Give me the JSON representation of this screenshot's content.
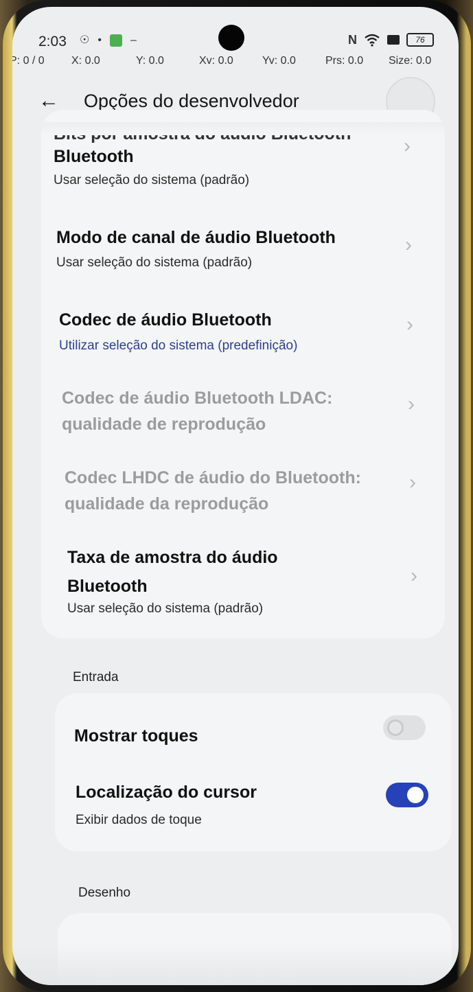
{
  "status_bar": {
    "time": "2:03",
    "battery": "76",
    "left_icons": [
      "vpn-icon",
      "notification-dot-icon",
      "app-notification-icon",
      "more-dots-icon"
    ],
    "right_icons": [
      "nfc-icon",
      "wifi-icon",
      "sim-icon",
      "battery-icon"
    ]
  },
  "pointer_location": {
    "p": "P: 0 / 0",
    "x": "X: 0.0",
    "y": "Y: 0.0",
    "xv": "Xv: 0.0",
    "yv": "Yv: 0.0",
    "prs": "Prs: 0.0",
    "size": "Size: 0.0"
  },
  "header": {
    "title": "Opções do desenvolvedor"
  },
  "audio_items": [
    {
      "title": "Bits por amostra do áudio Bluetooth",
      "title_line2": "Bluetooth",
      "subtitle": "Usar seleção do sistema (padrão)"
    },
    {
      "title": "Modo de canal de áudio Bluetooth",
      "subtitle": "Usar seleção do sistema (padrão)"
    },
    {
      "title": "Codec de áudio Bluetooth",
      "subtitle": "Utilizar seleção do sistema (predefinição)"
    },
    {
      "title": "Codec de áudio Bluetooth LDAC:",
      "title_line2": "qualidade de reprodução",
      "disabled": true
    },
    {
      "title": "Codec LHDC de áudio do Bluetooth:",
      "title_line2": "qualidade da reprodução",
      "disabled": true
    },
    {
      "title": "Taxa de amostra do áudio",
      "title_line2": "Bluetooth",
      "subtitle": "Usar seleção do sistema (padrão)"
    }
  ],
  "input_section": {
    "label": "Entrada",
    "items": [
      {
        "title": "Mostrar toques",
        "toggle": false
      },
      {
        "title": "Localização do cursor",
        "subtitle": "Exibir dados de toque",
        "toggle": true
      }
    ]
  },
  "drawing_section": {
    "label": "Desenho"
  },
  "colors": {
    "accent": "#2642b8",
    "subtitle_accent": "#2d3f8f",
    "disabled_text": "#9a9c9e"
  }
}
